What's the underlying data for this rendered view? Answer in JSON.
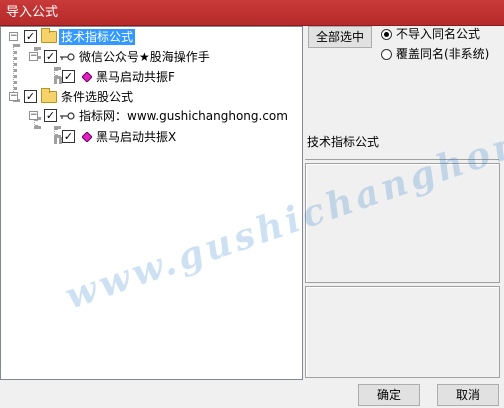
{
  "window": {
    "title": "导入公式"
  },
  "tree": [
    {
      "label": "技术指标公式",
      "type": "folder",
      "checked": true,
      "selected": true,
      "children": [
        {
          "label": "微信公众号★股海操作手",
          "type": "key",
          "checked": true,
          "children": [
            {
              "label": "黑马启动共振F",
              "type": "formula",
              "checked": true
            }
          ]
        }
      ]
    },
    {
      "label": "条件选股公式",
      "type": "folder",
      "checked": true,
      "selected": false,
      "children": [
        {
          "label": "指标网：www.gushichanghong.com",
          "type": "key",
          "checked": true,
          "children": [
            {
              "label": "黑马启动共振X",
              "type": "formula",
              "checked": true
            }
          ]
        }
      ]
    }
  ],
  "controls": {
    "select_all": "全部选中",
    "options": [
      {
        "label": "不导入同名公式",
        "checked": true
      },
      {
        "label": "覆盖同名(非系统)",
        "checked": false
      }
    ]
  },
  "detail_panel": {
    "title": "技术指标公式"
  },
  "watermark": "www.gushichanghong.com",
  "footer": {
    "ok": "确定",
    "cancel": "取消"
  },
  "colors": {
    "title_bar": "#c03232",
    "selection": "#3399ff"
  }
}
